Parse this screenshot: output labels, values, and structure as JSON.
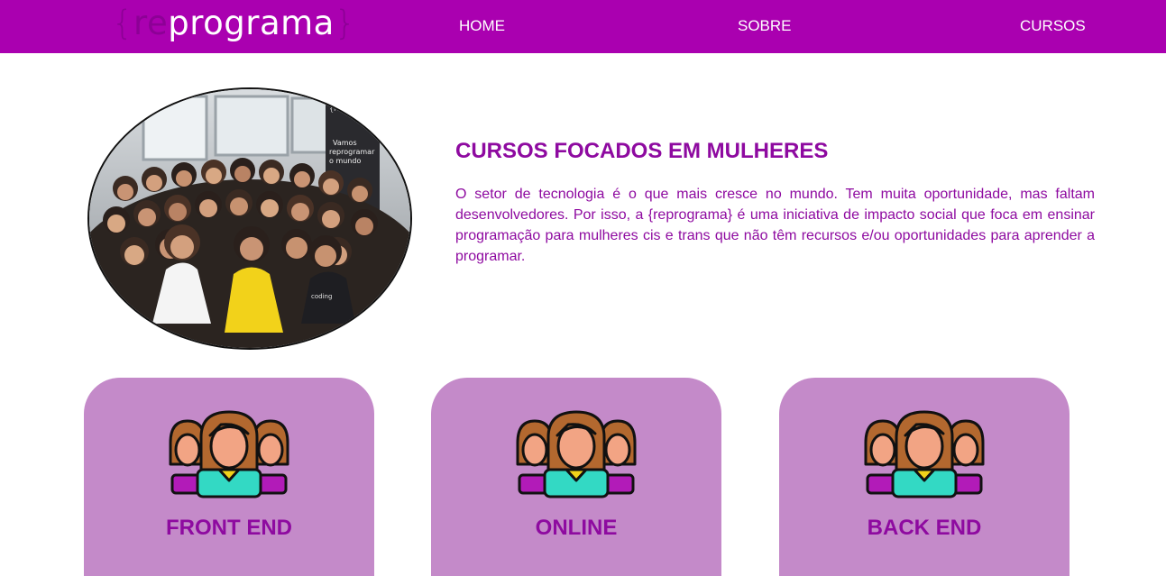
{
  "header": {
    "logo": {
      "brace_open": "{",
      "re": "re",
      "word": "programa",
      "brace_close": "}"
    },
    "nav": [
      {
        "label": "HOME"
      },
      {
        "label": "SOBRE"
      },
      {
        "label": "CURSOS"
      }
    ]
  },
  "hero": {
    "photo_text": {
      "banner_logo": "{re}programa",
      "banner_line1": "Vamos",
      "banner_line2": "reprogramar",
      "banner_line3": "o mundo",
      "shirt": "coding"
    },
    "title": "CURSOS FOCADOS EM MULHERES",
    "text": "O setor de tecnologia é o que mais cresce no mundo. Tem muita oportunidade, mas faltam desenvolvedores. Por isso, a {reprograma} é uma iniciativa de impacto social que foca em ensinar programação para mulheres cis e trans que não têm recursos e/ou oportunidades para aprender a programar."
  },
  "cards": [
    {
      "title": "FRONT END",
      "icon": "women-group-icon"
    },
    {
      "title": "ONLINE",
      "icon": "women-group-icon"
    },
    {
      "title": "BACK END",
      "icon": "women-group-icon"
    }
  ],
  "colors": {
    "header_bg": "#aa00b0",
    "accent_text": "#8e0aa0",
    "card_bg": "#c48ac9"
  }
}
